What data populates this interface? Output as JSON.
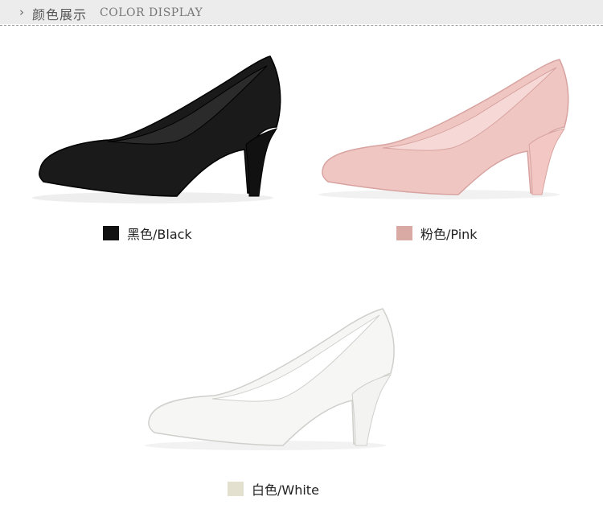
{
  "header": {
    "chevron": "›",
    "title_cn": "颜色展示",
    "title_en": "COLOR DISPLAY"
  },
  "colors": [
    {
      "label": "黑色/Black",
      "swatch": "#111111",
      "shoe_fill": "#1a1a1a",
      "shoe_edge": "#000000",
      "lining": "#2b2b2b",
      "heel": "#111111"
    },
    {
      "label": "粉色/Pink",
      "swatch": "#d9aaa4",
      "shoe_fill": "#f0c6c3",
      "shoe_edge": "#d7a3a0",
      "lining": "#f6d9d6",
      "heel": "#f2c7c4"
    },
    {
      "label": "白色/White",
      "swatch": "#e4e0d0",
      "shoe_fill": "#f6f6f4",
      "shoe_edge": "#cfcfcb",
      "lining": "#ffffff",
      "heel": "#f3f3f1"
    }
  ]
}
